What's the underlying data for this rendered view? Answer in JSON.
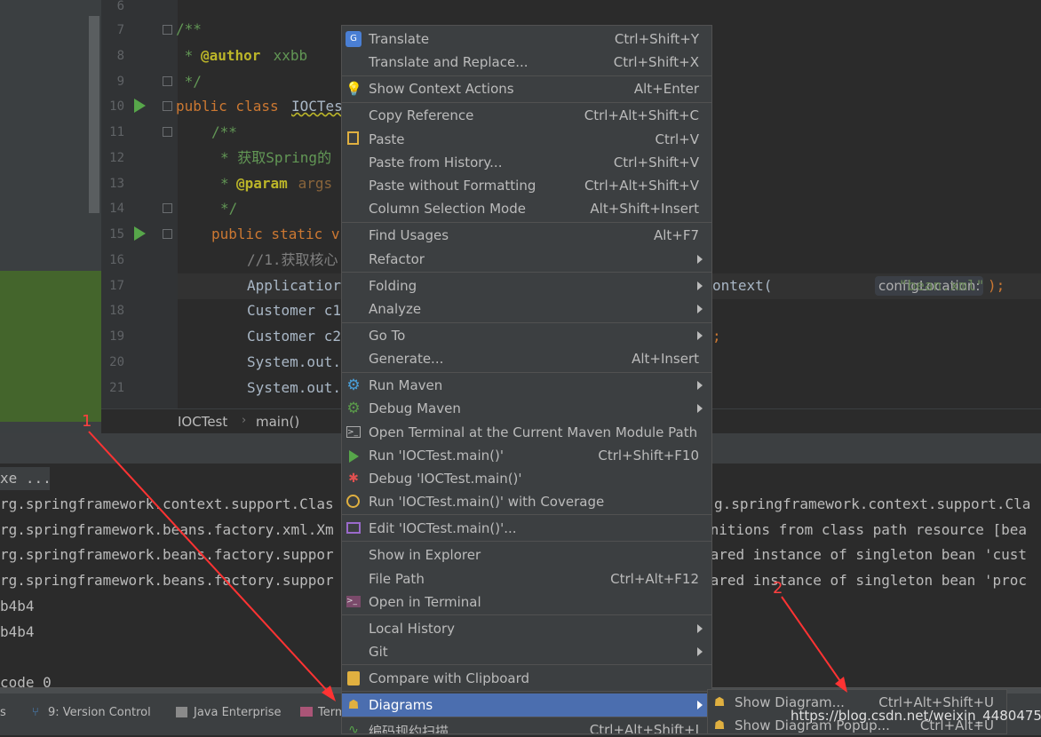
{
  "editor": {
    "line_numbers": [
      "6",
      "7",
      "8",
      "9",
      "10",
      "11",
      "12",
      "13",
      "14",
      "15",
      "16",
      "17",
      "18",
      "19",
      "20",
      "21"
    ],
    "lines": [
      {
        "id": "l7",
        "text": "/**"
      },
      {
        "id": "l8a",
        "text": " * "
      },
      {
        "id": "l8b",
        "text": "@author"
      },
      {
        "id": "l8c",
        "text": " xxbb"
      },
      {
        "id": "l9",
        "text": " */"
      },
      {
        "id": "l10a",
        "text": "public class "
      },
      {
        "id": "l10b",
        "text": "IOCTes"
      },
      {
        "id": "l11",
        "text": "/**"
      },
      {
        "id": "l12",
        "text": "* 获取Spring的"
      },
      {
        "id": "l13a",
        "text": "* "
      },
      {
        "id": "l13b",
        "text": "@param"
      },
      {
        "id": "l13c",
        "text": " args"
      },
      {
        "id": "l14",
        "text": "*/"
      },
      {
        "id": "l15",
        "text": "public static v"
      },
      {
        "id": "l16",
        "text": "//1.获取核心"
      },
      {
        "id": "l17a",
        "text": "Applicatior"
      },
      {
        "id": "l17b",
        "text": "ontext("
      },
      {
        "id": "l17c",
        "text": "\"bean.xml\""
      },
      {
        "id": "l17d",
        "text": ");"
      },
      {
        "id": "l18",
        "text": "Customer c1"
      },
      {
        "id": "l19",
        "text": "Customer c2"
      },
      {
        "id": "l19b",
        "text": ";"
      },
      {
        "id": "l20",
        "text": "System.out."
      },
      {
        "id": "l21",
        "text": "System.out."
      }
    ],
    "param_hint": "configLocation:"
  },
  "breadcrumb": {
    "class": "IOCTest",
    "method": "main()"
  },
  "console": {
    "lines_left": [
      "xe ...",
      "rg.springframework.context.support.Clas",
      "rg.springframework.beans.factory.xml.Xm",
      "rg.springframework.beans.factory.suppor",
      "rg.springframework.beans.factory.suppor",
      "b4b4",
      "b4b4",
      "",
      "code 0"
    ],
    "lines_right": [
      "",
      "g.springframework.context.support.Cla",
      "initions from class path resource [bea",
      "hared instance of singleton bean 'cust",
      "hared instance of singleton bean 'proc"
    ]
  },
  "toolbar": {
    "items": [
      "s",
      "9: Version Control",
      "Java Enterprise",
      "Term"
    ],
    "mnemonic_underline": "9"
  },
  "menu": {
    "items": [
      {
        "label": "Translate",
        "shortcut": "Ctrl+Shift+Y",
        "icon": "translate-icon"
      },
      {
        "label": "Translate and Replace...",
        "shortcut": "Ctrl+Shift+X"
      },
      {
        "label": "Show Context Actions",
        "shortcut": "Alt+Enter",
        "icon": "bulb-icon"
      },
      {
        "label": "Copy Reference",
        "shortcut": "Ctrl+Alt+Shift+C"
      },
      {
        "label": "Paste",
        "shortcut": "Ctrl+V",
        "icon": "clipboard-icon"
      },
      {
        "label": "Paste from History...",
        "shortcut": "Ctrl+Shift+V"
      },
      {
        "label": "Paste without Formatting",
        "shortcut": "Ctrl+Alt+Shift+V"
      },
      {
        "label": "Column Selection Mode",
        "shortcut": "Alt+Shift+Insert"
      },
      {
        "label": "Find Usages",
        "shortcut": "Alt+F7"
      },
      {
        "label": "Refactor",
        "submenu": true
      },
      {
        "label": "Folding",
        "submenu": true
      },
      {
        "label": "Analyze",
        "submenu": true
      },
      {
        "label": "Go To",
        "submenu": true
      },
      {
        "label": "Generate...",
        "shortcut": "Alt+Insert"
      },
      {
        "label": "Run Maven",
        "submenu": true,
        "icon": "gear-icon"
      },
      {
        "label": "Debug Maven",
        "submenu": true,
        "icon": "debug-gear-icon"
      },
      {
        "label": "Open Terminal at the Current Maven Module Path",
        "icon": "terminal-icon"
      },
      {
        "label": "Run 'IOCTest.main()'",
        "shortcut": "Ctrl+Shift+F10",
        "icon": "run-icon"
      },
      {
        "label": "Debug 'IOCTest.main()'",
        "icon": "bug-icon"
      },
      {
        "label": "Run 'IOCTest.main()' with Coverage",
        "icon": "coverage-icon"
      },
      {
        "label": "Edit 'IOCTest.main()'...",
        "icon": "edit-config-icon"
      },
      {
        "label": "Show in Explorer"
      },
      {
        "label": "File Path",
        "shortcut": "Ctrl+Alt+F12"
      },
      {
        "label": "Open in Terminal",
        "icon": "terminal-icon"
      },
      {
        "label": "Local History",
        "submenu": true
      },
      {
        "label": "Git",
        "submenu": true
      },
      {
        "label": "Compare with Clipboard",
        "icon": "compare-icon"
      },
      {
        "label": "Diagrams",
        "submenu": true,
        "icon": "diagram-icon",
        "selected": true
      },
      {
        "label": "编码规约扫描",
        "shortcut": "Ctrl+Alt+Shift+J",
        "icon": "scan-icon"
      }
    ]
  },
  "submenu": {
    "items": [
      {
        "label": "Show Diagram...",
        "shortcut": "Ctrl+Alt+Shift+U",
        "icon": "diagram-icon"
      },
      {
        "label": "Show Diagram Popup...",
        "shortcut": "Ctrl+Alt+U",
        "icon": "diagram-icon"
      }
    ]
  },
  "annotations": {
    "marker1": "1",
    "marker2": "2",
    "color": "#ff3333"
  },
  "watermark": "https://blog.csdn.net/weixin_44804750",
  "colors": {
    "keyword": "#cc7832",
    "annotation": "#bbb529",
    "comment": "#629755",
    "string": "#6a8759",
    "selection": "#4b6eaf",
    "run_green": "#57a64a"
  }
}
